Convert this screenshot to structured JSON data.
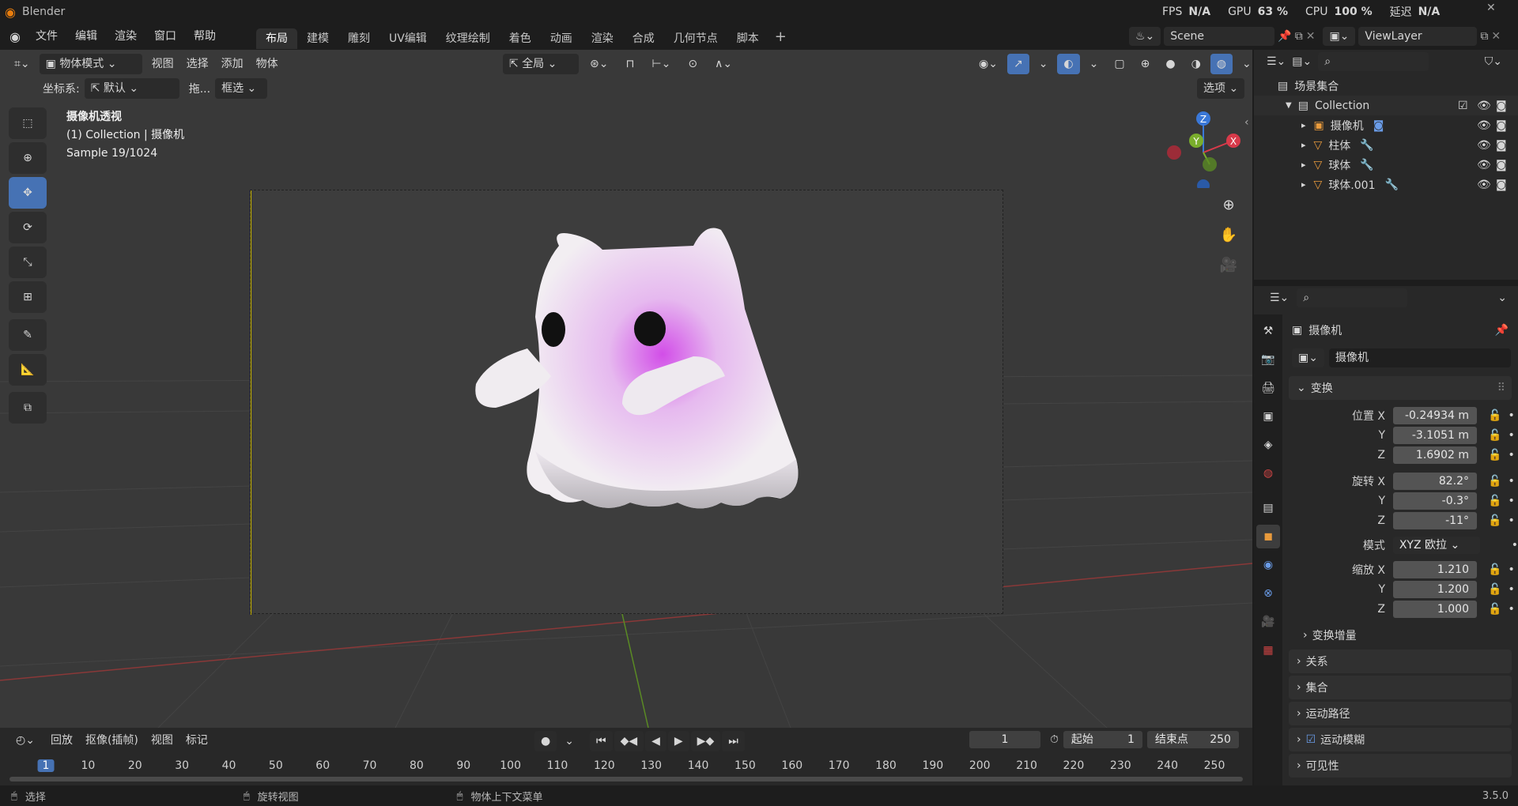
{
  "window": {
    "title": "Blender",
    "version": "3.5.0"
  },
  "menu": [
    "文件",
    "编辑",
    "渲染",
    "窗口",
    "帮助"
  ],
  "workspaces": [
    "布局",
    "建模",
    "雕刻",
    "UV编辑",
    "纹理绘制",
    "着色",
    "动画",
    "渲染",
    "合成",
    "几何节点",
    "脚本"
  ],
  "active_workspace": 0,
  "stats": {
    "fps_label": "FPS",
    "fps": "N/A",
    "gpu_label": "GPU",
    "gpu": "63 %",
    "cpu_label": "CPU",
    "cpu": "100 %",
    "latency_label": "延迟",
    "latency": "N/A"
  },
  "scene": {
    "name": "Scene",
    "view_layer": "ViewLayer"
  },
  "viewport": {
    "mode": "物体模式",
    "menus": [
      "视图",
      "选择",
      "添加",
      "物体"
    ],
    "orientation": "全局",
    "coord_label": "坐标系:",
    "coord_value": "默认",
    "drag_label": "拖...",
    "drag_value": "框选",
    "options": "选项",
    "info_lines": [
      "摄像机透视",
      "(1) Collection | 摄像机",
      "Sample 19/1024"
    ],
    "gizmo_axes": {
      "z": "Z",
      "y": "Y",
      "x": "X"
    }
  },
  "outliner": {
    "root": "场景集合",
    "collection": "Collection",
    "items": [
      "摄像机",
      "柱体",
      "球体",
      "球体.001"
    ]
  },
  "properties": {
    "object_name": "摄像机",
    "data_name": "摄像机",
    "transform_label": "变换",
    "location_label": "位置 X",
    "location": [
      "-0.24934 m",
      "-3.1051 m",
      "1.6902 m"
    ],
    "rotation_label": "旋转 X",
    "rotation": [
      "82.2°",
      "-0.3°",
      "-11°"
    ],
    "mode_label": "模式",
    "mode_value": "XYZ 欧拉",
    "scale_label": "缩放 X",
    "scale": [
      "1.210",
      "1.200",
      "1.000"
    ],
    "axis_y": "Y",
    "axis_z": "Z",
    "delta_label": "变换增量",
    "panels": [
      "关系",
      "集合",
      "运动路径",
      "运动模糊",
      "可见性"
    ]
  },
  "timeline": {
    "menus": [
      "回放",
      "抠像(插帧)",
      "视图",
      "标记"
    ],
    "current_frame": "1",
    "start_label": "起始",
    "start": "1",
    "end_label": "结束点",
    "end": "250",
    "ticks": [
      "1",
      "10",
      "20",
      "30",
      "40",
      "50",
      "60",
      "70",
      "80",
      "90",
      "100",
      "110",
      "120",
      "130",
      "140",
      "150",
      "160",
      "170",
      "180",
      "190",
      "200",
      "210",
      "220",
      "230",
      "240",
      "250"
    ]
  },
  "status": {
    "select": "选择",
    "rotate": "旋转视图",
    "context": "物体上下文菜单"
  }
}
